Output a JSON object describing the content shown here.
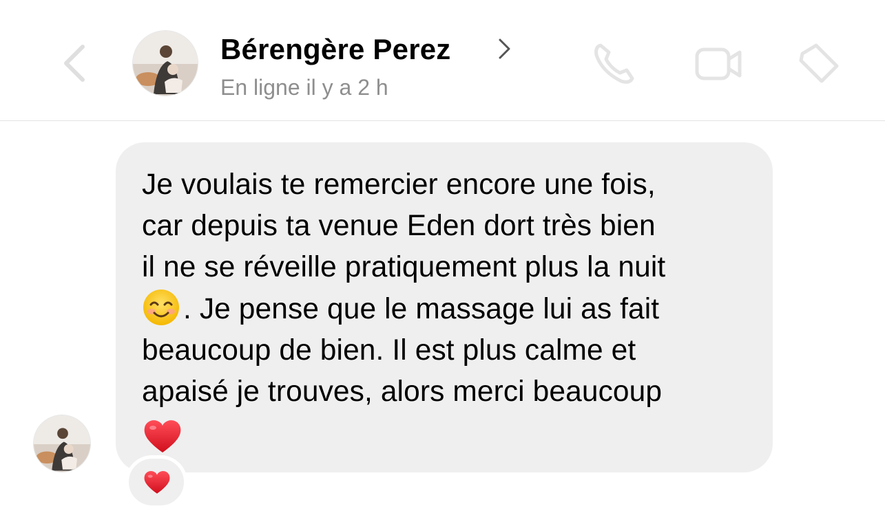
{
  "header": {
    "contact_name": "Bérengère Perez",
    "status": "En ligne il y a 2 h",
    "icons": [
      "back-arrow-icon",
      "chevron-right-icon",
      "phone-icon",
      "video-camera-icon",
      "info-icon"
    ]
  },
  "message": {
    "lines": [
      "Je voulais te remercier encore une fois,",
      "car depuis ta venue Eden dort très bien",
      "il ne se réveille pratiquement plus la nuit",
      ". Je pense que le massage lui as fait",
      "beaucoup de bien. Il est plus calme et",
      "apaisé je trouves, alors merci beaucoup"
    ],
    "emojis": [
      "smiling-face-emoji",
      "red-heart-emoji"
    ],
    "reaction": "red-heart-emoji"
  },
  "colors": {
    "bubble": "#efefef",
    "status_text": "#8e8e8e",
    "divider": "#e3e3e3",
    "heart": "#e0202e"
  }
}
